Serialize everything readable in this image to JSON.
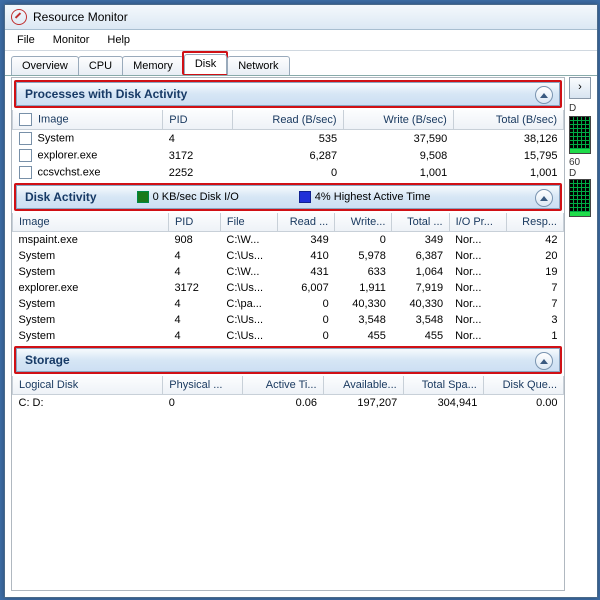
{
  "window": {
    "title": "Resource Monitor"
  },
  "menu": {
    "file": "File",
    "monitor": "Monitor",
    "help": "Help"
  },
  "tabs": {
    "overview": "Overview",
    "cpu": "CPU",
    "memory": "Memory",
    "disk": "Disk",
    "network": "Network"
  },
  "proc": {
    "title": "Processes with Disk Activity",
    "cols": {
      "image": "Image",
      "pid": "PID",
      "read": "Read (B/sec)",
      "write": "Write (B/sec)",
      "total": "Total (B/sec)"
    },
    "rows": [
      {
        "image": "System",
        "pid": "4",
        "read": "535",
        "write": "37,590",
        "total": "38,126"
      },
      {
        "image": "explorer.exe",
        "pid": "3172",
        "read": "6,287",
        "write": "9,508",
        "total": "15,795"
      },
      {
        "image": "ccsvchst.exe",
        "pid": "2252",
        "read": "0",
        "write": "1,001",
        "total": "1,001"
      }
    ]
  },
  "act": {
    "title": "Disk Activity",
    "io": "0 KB/sec Disk I/O",
    "hat": "4% Highest Active Time",
    "cols": {
      "image": "Image",
      "pid": "PID",
      "file": "File",
      "read": "Read ...",
      "write": "Write...",
      "total": "Total ...",
      "pri": "I/O Pr...",
      "resp": "Resp..."
    },
    "rows": [
      {
        "image": "mspaint.exe",
        "pid": "908",
        "file": "C:\\W...",
        "read": "349",
        "write": "0",
        "total": "349",
        "pri": "Nor...",
        "resp": "42"
      },
      {
        "image": "System",
        "pid": "4",
        "file": "C:\\Us...",
        "read": "410",
        "write": "5,978",
        "total": "6,387",
        "pri": "Nor...",
        "resp": "20"
      },
      {
        "image": "System",
        "pid": "4",
        "file": "C:\\W...",
        "read": "431",
        "write": "633",
        "total": "1,064",
        "pri": "Nor...",
        "resp": "19"
      },
      {
        "image": "explorer.exe",
        "pid": "3172",
        "file": "C:\\Us...",
        "read": "6,007",
        "write": "1,911",
        "total": "7,919",
        "pri": "Nor...",
        "resp": "7"
      },
      {
        "image": "System",
        "pid": "4",
        "file": "C:\\pa...",
        "read": "0",
        "write": "40,330",
        "total": "40,330",
        "pri": "Nor...",
        "resp": "7"
      },
      {
        "image": "System",
        "pid": "4",
        "file": "C:\\Us...",
        "read": "0",
        "write": "3,548",
        "total": "3,548",
        "pri": "Nor...",
        "resp": "3"
      },
      {
        "image": "System",
        "pid": "4",
        "file": "C:\\Us...",
        "read": "0",
        "write": "455",
        "total": "455",
        "pri": "Nor...",
        "resp": "1"
      }
    ]
  },
  "stor": {
    "title": "Storage",
    "cols": {
      "ldisk": "Logical Disk",
      "pdisk": "Physical ...",
      "atime": "Active Ti...",
      "avail": "Available...",
      "tspace": "Total Spa...",
      "queue": "Disk Que..."
    },
    "rows": [
      {
        "ldisk": "C: D:",
        "pdisk": "0",
        "atime": "0.06",
        "avail": "197,207",
        "tspace": "304,941",
        "queue": "0.00"
      }
    ]
  },
  "side": {
    "labels": [
      "60",
      "D"
    ]
  }
}
